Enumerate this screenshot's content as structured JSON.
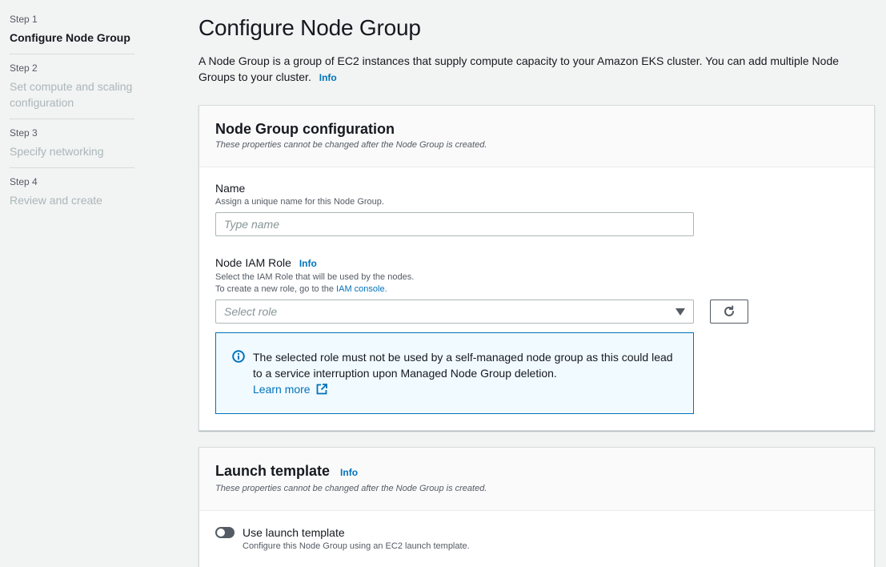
{
  "steps": [
    {
      "num": "Step 1",
      "title": "Configure Node Group"
    },
    {
      "num": "Step 2",
      "title": "Set compute and scaling configuration"
    },
    {
      "num": "Step 3",
      "title": "Specify networking"
    },
    {
      "num": "Step 4",
      "title": "Review and create"
    }
  ],
  "page": {
    "title": "Configure Node Group",
    "description": "A Node Group is a group of EC2 instances that supply compute capacity to your Amazon EKS cluster. You can add multiple Node Groups to your cluster.",
    "info": "Info"
  },
  "node_group_config": {
    "title": "Node Group configuration",
    "subtitle": "These properties cannot be changed after the Node Group is created.",
    "name": {
      "label": "Name",
      "description": "Assign a unique name for this Node Group.",
      "placeholder": "Type name",
      "value": ""
    },
    "role": {
      "label": "Node IAM Role",
      "info": "Info",
      "description1": "Select the IAM Role that will be used by the nodes.",
      "description2_prefix": "To create a new role, go to the",
      "console_link": "IAM console",
      "description2_suffix": ".",
      "placeholder": "Select role"
    },
    "alert": {
      "text": "The selected role must not be used by a self-managed node group as this could lead to a service interruption upon Managed Node Group deletion.",
      "learn_more": "Learn more"
    }
  },
  "launch_template": {
    "title": "Launch template",
    "info": "Info",
    "subtitle": "These properties cannot be changed after the Node Group is created.",
    "toggle_label": "Use launch template",
    "toggle_desc": "Configure this Node Group using an EC2 launch template.",
    "toggle_on": false
  },
  "colors": {
    "link": "#0073bb",
    "background": "#f2f3f3",
    "alert_bg": "#f1faff"
  }
}
